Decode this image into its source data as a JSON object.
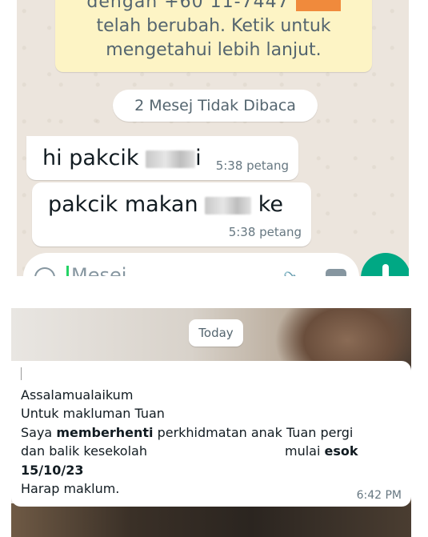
{
  "top_chat": {
    "system_notice": {
      "partial_line": "dengan +60 11-7447",
      "line_2": "telah berubah. Ketik untuk",
      "line_3": "mengetahui lebih lanjut."
    },
    "unread_label": "2 Mesej Tidak Dibaca",
    "messages": [
      {
        "before": "hi pakcik",
        "after": "i",
        "time": "5:38 petang"
      },
      {
        "before": "pakcik makan",
        "after": "ke",
        "time": "5:38 petang"
      }
    ],
    "composer": {
      "placeholder": "Mesej"
    }
  },
  "bottom_chat": {
    "date_chip": "Today",
    "message": {
      "line_1": "Assalamualaikum",
      "line_2": "Untuk makluman Tuan",
      "line_3_pre": "Saya ",
      "line_3_bold": "memberhenti",
      "line_3_post": " perkhidmatan anak Tuan pergi",
      "line_4": "dan balik kesekolah",
      "line_4b_pre": "mulai ",
      "line_4b_bold": "esok",
      "line_5": "15/10/23",
      "line_6": "Harap maklum.",
      "time": "6:42 PM"
    }
  },
  "colors": {
    "chat_wallpaper": "#ece5dd",
    "system_notice_bg": "#fdf4c5",
    "accent_green": "#00a884",
    "redaction_orange": "#f08a3c"
  },
  "icons": [
    "emoji-icon",
    "attach-icon",
    "camera-icon",
    "mic-icon"
  ]
}
